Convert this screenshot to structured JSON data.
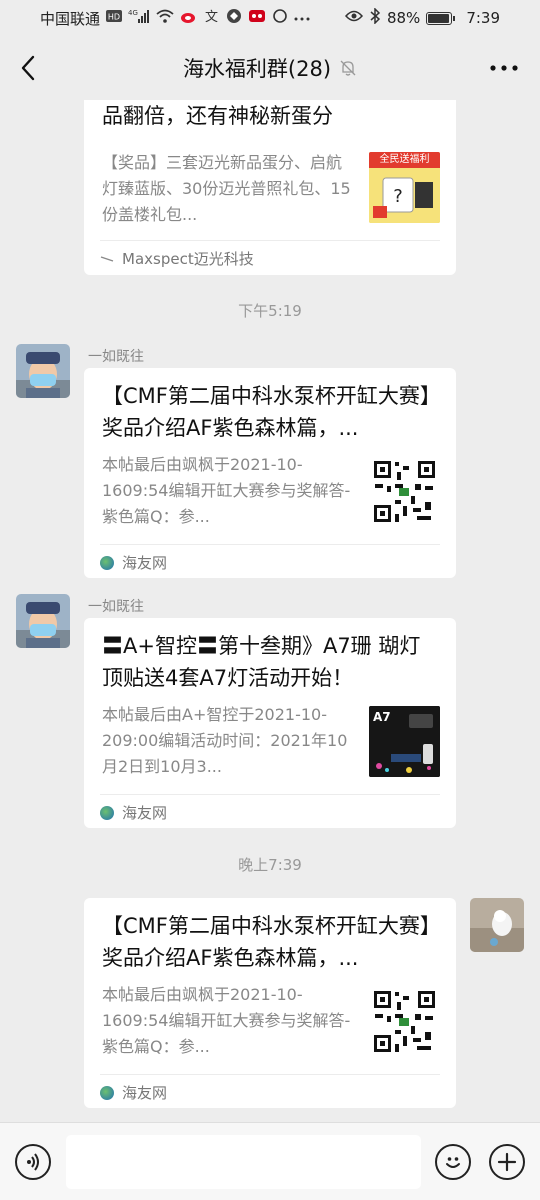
{
  "status_bar": {
    "carrier": "中国联通",
    "network": "4G",
    "battery": "88%",
    "time": "7:39"
  },
  "header": {
    "title": "海水福利群(28)"
  },
  "messages": [
    {
      "title": "【迈光优福大赛】全民送福利，奖品翻倍，还有神秘新蛋分",
      "desc": "【奖品】三套迈光新品蛋分、启航灯臻蓝版、30份迈光普照礼包、15份盖楼礼包...",
      "source": "Maxspect迈光科技",
      "thumb_text": "全民送福利"
    },
    {
      "time": "下午5:19",
      "sender": "一如既往",
      "title": "【CMF第二届中科水泵杯开缸大赛】奖品介绍AF紫色森林篇，...",
      "desc": "本帖最后由飒枫于2021-10-1609:54编辑开缸大赛参与奖解答-紫色篇Q：参...",
      "source": "海友网"
    },
    {
      "sender": "一如既往",
      "title": "〓A+智控〓第十叁期》A7珊 瑚灯顶贴送4套A7灯活动开始！",
      "desc": "本帖最后由A+智控于2021-10-209:00编辑活动时间：2021年10月2日到10月3...",
      "source": "海友网",
      "thumb_text": "A7"
    },
    {
      "time": "晚上7:39",
      "title": "【CMF第二届中科水泵杯开缸大赛】奖品介绍AF紫色森林篇，...",
      "desc": "本帖最后由飒枫于2021-10-1609:54编辑开缸大赛参与奖解答-紫色篇Q：参...",
      "source": "海友网"
    }
  ],
  "input": {
    "placeholder": ""
  },
  "colors": {
    "background": "#ededed",
    "card": "#ffffff",
    "bottom_bar": "#f7f7f7"
  },
  "icons": [
    "back-arrow-icon",
    "mute-bell-icon",
    "more-dots-icon",
    "voice-icon",
    "emoji-icon",
    "plus-icon"
  ]
}
